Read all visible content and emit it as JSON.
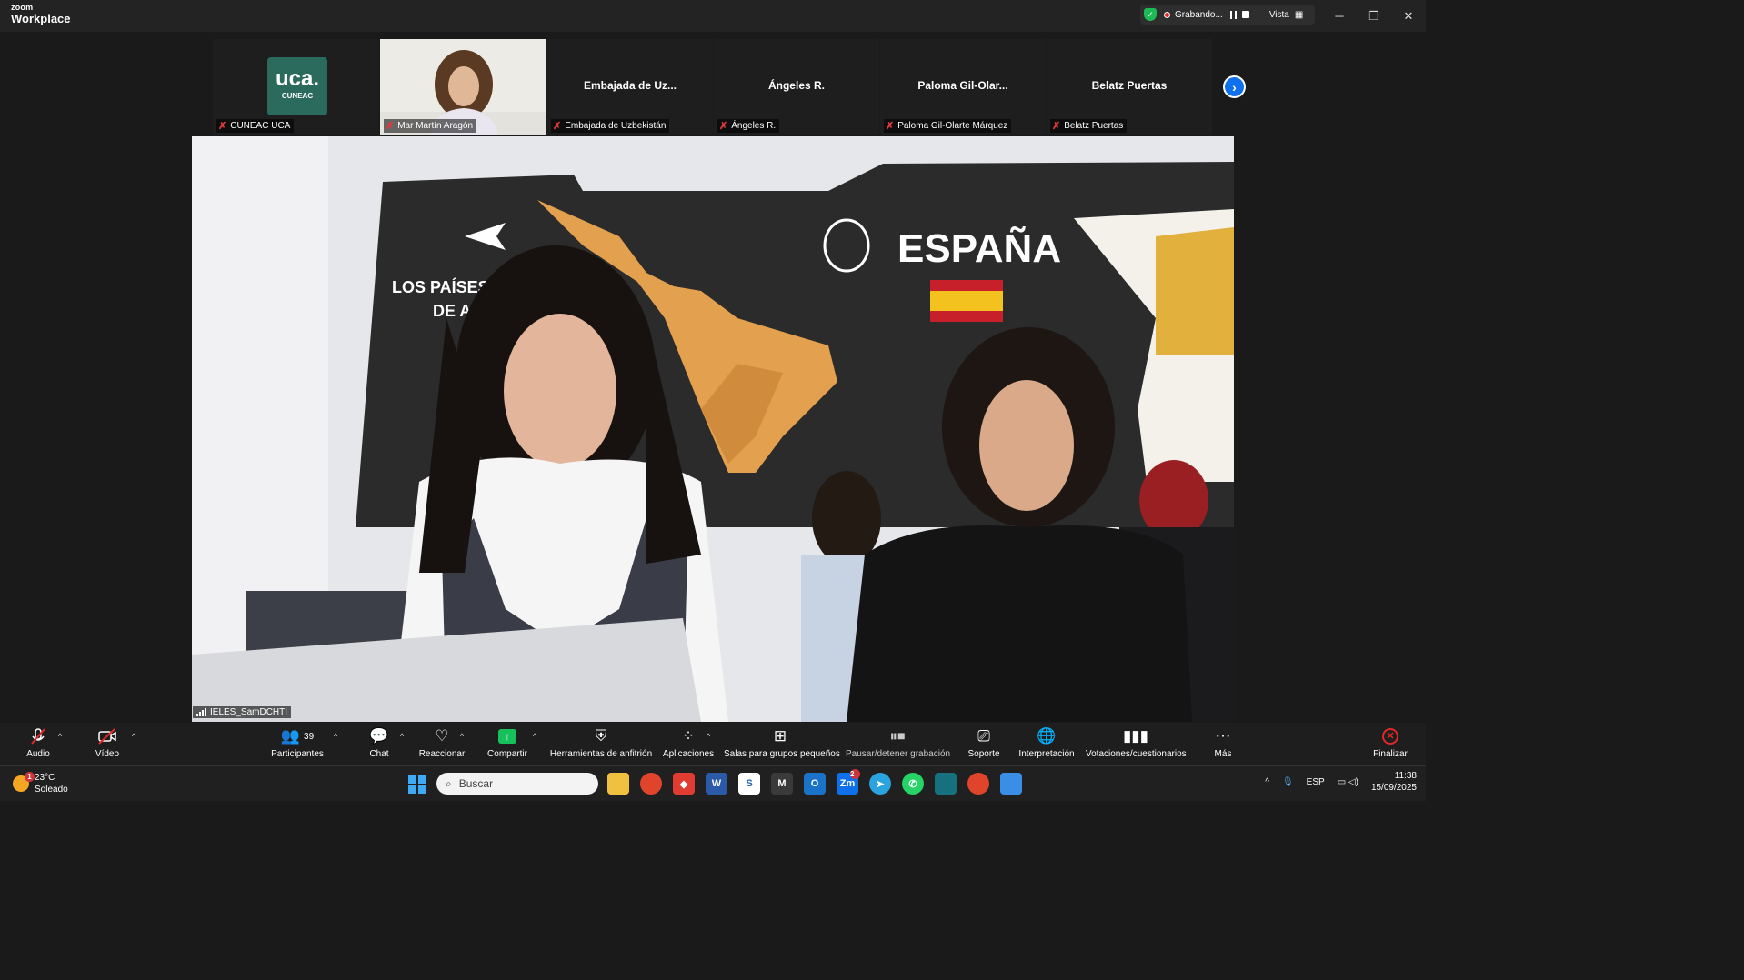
{
  "titlebar": {
    "brand_small": "zoom",
    "brand_big": "Workplace",
    "recording_label": "Grabando...",
    "view_label": "Vista",
    "window_buttons": [
      "─",
      "❐",
      "✕"
    ]
  },
  "gallery": {
    "tiles": [
      {
        "tile_name": "",
        "label": "CUNEAC UCA",
        "logo_big": "uca.",
        "logo_small": "CUNEAC"
      },
      {
        "tile_name": "",
        "label": "Mar Martín Aragón"
      },
      {
        "tile_name": "Embajada  de  Uz...",
        "label": "Embajada de Uzbekistán"
      },
      {
        "tile_name": "Ángeles R.",
        "label": "Ángeles R."
      },
      {
        "tile_name": "Paloma  Gil-Olar...",
        "label": "Paloma Gil-Olarte Márquez"
      },
      {
        "tile_name": "Belatz Puertas",
        "label": "Belatz Puertas"
      }
    ]
  },
  "main_video": {
    "participant_label": "IELES_SamDCHTI",
    "map_title": "LOS PAÍSES HISPA DE AMÉRI",
    "map_title_line1": "LOS PAÍSES HISPA",
    "map_title_line2": "DE AMÉRI",
    "espana": "ESPAÑA"
  },
  "toolbar": {
    "audio": "Audio",
    "video": "Vídeo",
    "participants": "Participantes",
    "participants_count": "39",
    "chat": "Chat",
    "react": "Reaccionar",
    "share": "Compartir",
    "host_tools": "Herramientas de anfitrión",
    "apps": "Aplicaciones",
    "breakout": "Salas para grupos pequeños",
    "pause_rec": "Pausar/detener grabación",
    "support": "Soporte",
    "interpretation": "Interpretación",
    "polls": "Votaciones/cuestionarios",
    "more": "Más",
    "end": "Finalizar"
  },
  "taskbar": {
    "weather_badge": "1",
    "temperature": "23°C",
    "condition": "Soleado",
    "search_placeholder": "Buscar",
    "zoom_badge": "2",
    "lang": "ESP",
    "time": "11:38",
    "date": "15/09/2025"
  },
  "colors": {
    "zoom_blue": "#0e71eb",
    "share_green": "#16c05a",
    "end_red": "#e02828",
    "uca_green": "#2a6b5e"
  }
}
